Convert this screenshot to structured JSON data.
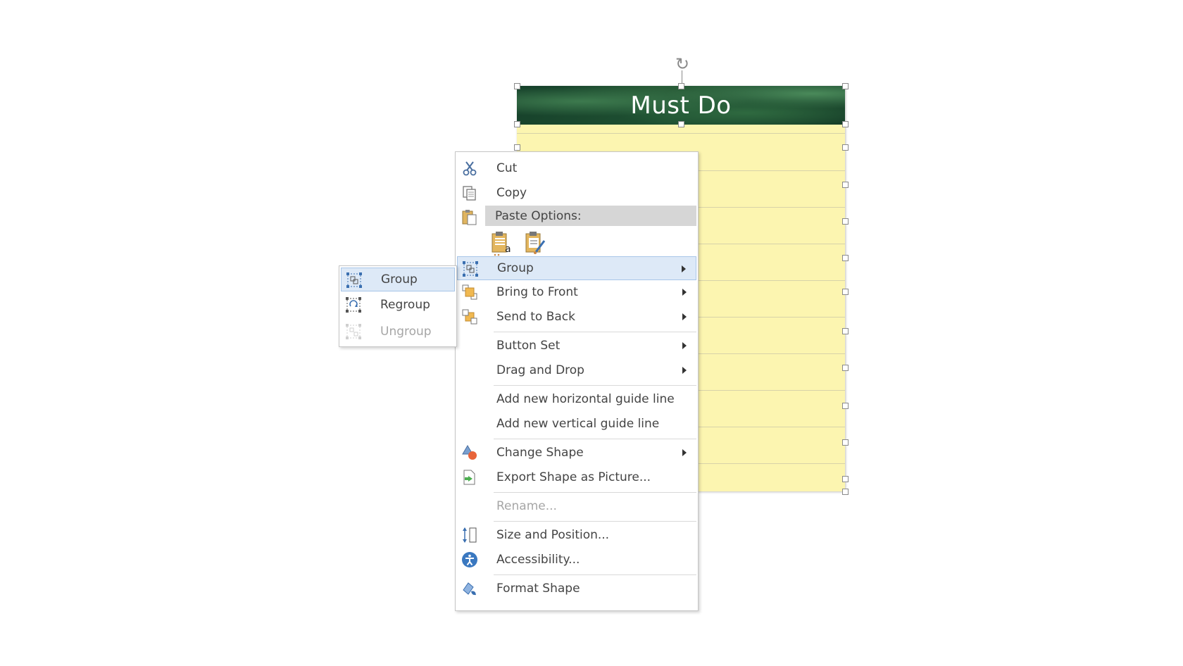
{
  "note": {
    "title": "Must Do"
  },
  "context_menu": {
    "cut": "Cut",
    "copy": "Copy",
    "paste_options": "Paste Options:",
    "paste_buttons": [
      "Keep Source Formatting",
      "Keep Text Only"
    ],
    "group": "Group",
    "bring_to_front": "Bring to Front",
    "send_to_back": "Send to Back",
    "button_set": "Button Set",
    "drag_and_drop": "Drag and Drop",
    "add_horizontal_guide": "Add new horizontal guide line",
    "add_vertical_guide": "Add new vertical guide line",
    "change_shape": "Change Shape",
    "export_shape": "Export Shape as Picture...",
    "rename": "Rename...",
    "size_and_position": "Size and Position...",
    "accessibility": "Accessibility...",
    "format_shape": "Format Shape"
  },
  "submenu": {
    "group": "Group",
    "regroup": "Regroup",
    "ungroup": "Ungroup"
  },
  "colors": {
    "header_green": "#1f5132",
    "note_yellow": "#fcf5b0",
    "highlight": "#dde9f7",
    "paste_header_bg": "#d6d6d6"
  }
}
